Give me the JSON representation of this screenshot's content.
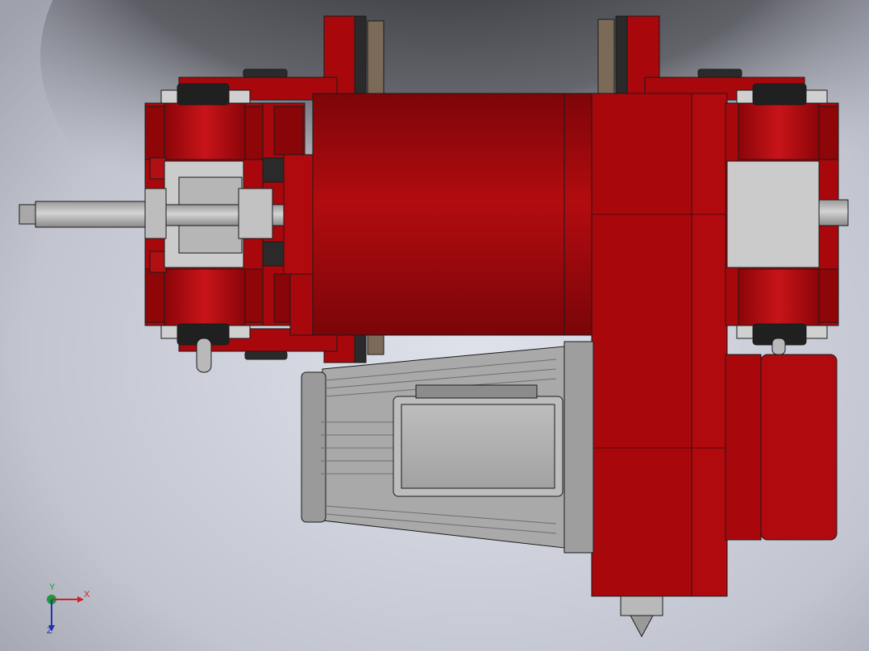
{
  "viewport": {
    "background_center": "#d7dae4",
    "background_edge": "#9a9ba6",
    "shadow_color": "#2b2c30"
  },
  "model": {
    "part_color": "#a8080c",
    "part_shade": "#7a0508",
    "part_highlight": "#cf1a1a",
    "metal_color": "#c6c6c6",
    "metal_shade": "#8e8e8e",
    "dark_part_color": "#2a2a2a",
    "rail_color": "#7c6a58",
    "edge_color": "#1a1a1a"
  },
  "triad": {
    "x_label": "X",
    "y_label": "Y",
    "z_label": "Z",
    "x_color": "#d0202a",
    "y_color": "#1a9a3a",
    "z_color": "#2030b0"
  }
}
